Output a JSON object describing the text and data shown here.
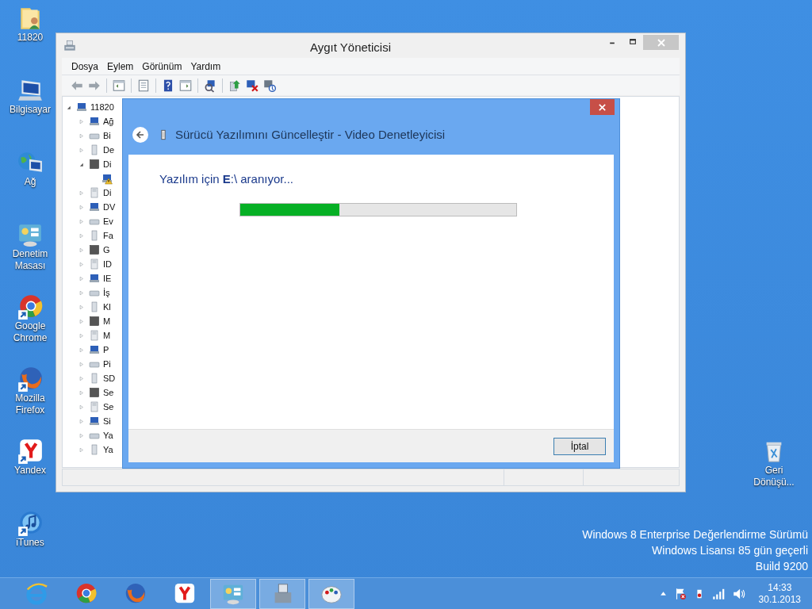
{
  "desktop_icons": [
    {
      "label": "11820",
      "kind": "user-folder",
      "shortcut": false
    },
    {
      "label": "Bilgisayar",
      "kind": "computer",
      "shortcut": false
    },
    {
      "label": "Ağ",
      "kind": "network",
      "shortcut": false
    },
    {
      "label": "Denetim Masası",
      "kind": "control-panel",
      "shortcut": false
    },
    {
      "label": "Google Chrome",
      "kind": "chrome",
      "shortcut": true
    },
    {
      "label": "Mozilla Firefox",
      "kind": "firefox",
      "shortcut": true
    },
    {
      "label": "Yandex",
      "kind": "yandex",
      "shortcut": true
    },
    {
      "label": "iTunes",
      "kind": "itunes",
      "shortcut": true
    }
  ],
  "recycle_bin": {
    "label": "Geri Dönüşü..."
  },
  "device_manager": {
    "title": "Aygıt Yöneticisi",
    "menu": [
      "Dosya",
      "Eylem",
      "Görünüm",
      "Yardım"
    ],
    "tree": {
      "label": "11820",
      "expanded": true,
      "children": [
        {
          "label": "Ağ",
          "expanded": false
        },
        {
          "label": "Bi",
          "expanded": false
        },
        {
          "label": "De",
          "expanded": false
        },
        {
          "label": "Di",
          "expanded": true,
          "children": [
            {
              "warning": true
            }
          ]
        },
        {
          "label": "Di",
          "expanded": false
        },
        {
          "label": "DV",
          "expanded": false
        },
        {
          "label": "Ev",
          "expanded": false
        },
        {
          "label": "Fa",
          "expanded": false
        },
        {
          "label": "G",
          "expanded": false
        },
        {
          "label": "ID",
          "expanded": false
        },
        {
          "label": "IE",
          "expanded": false
        },
        {
          "label": "İş",
          "expanded": false
        },
        {
          "label": "Kl",
          "expanded": false
        },
        {
          "label": "M",
          "expanded": false
        },
        {
          "label": "M",
          "expanded": false
        },
        {
          "label": "P",
          "expanded": false
        },
        {
          "label": "Pi",
          "expanded": false
        },
        {
          "label": "SD",
          "expanded": false
        },
        {
          "label": "Se",
          "expanded": false
        },
        {
          "label": "Se",
          "expanded": false
        },
        {
          "label": "Si",
          "expanded": false
        },
        {
          "label": "Ya",
          "expanded": false
        },
        {
          "label": "Ya",
          "expanded": false
        }
      ]
    }
  },
  "dialog": {
    "title": "Sürücü Yazılımını Güncelleştir - Video Denetleyicisi",
    "status": "Yazılım için **E**:\\ aranıyor...",
    "progress": {
      "level": 0.36
    },
    "cancel_button": "İptal"
  },
  "edition_text": [
    "Windows 8 Enterprise Değerlendirme Sürümü",
    "Windows Lisansı 85 gün geçerli",
    "Build 9200"
  ],
  "taskbar": {
    "items": [
      {
        "kind": "ie",
        "active": false
      },
      {
        "kind": "chrome",
        "active": false
      },
      {
        "kind": "firefox",
        "active": false
      },
      {
        "kind": "yandex",
        "active": false
      },
      {
        "kind": "control-panel",
        "active": true
      },
      {
        "kind": "device-manager",
        "active": true
      },
      {
        "kind": "paint",
        "active": true
      }
    ],
    "clock": {
      "time": "14:33",
      "date": "30.1.2013"
    }
  }
}
